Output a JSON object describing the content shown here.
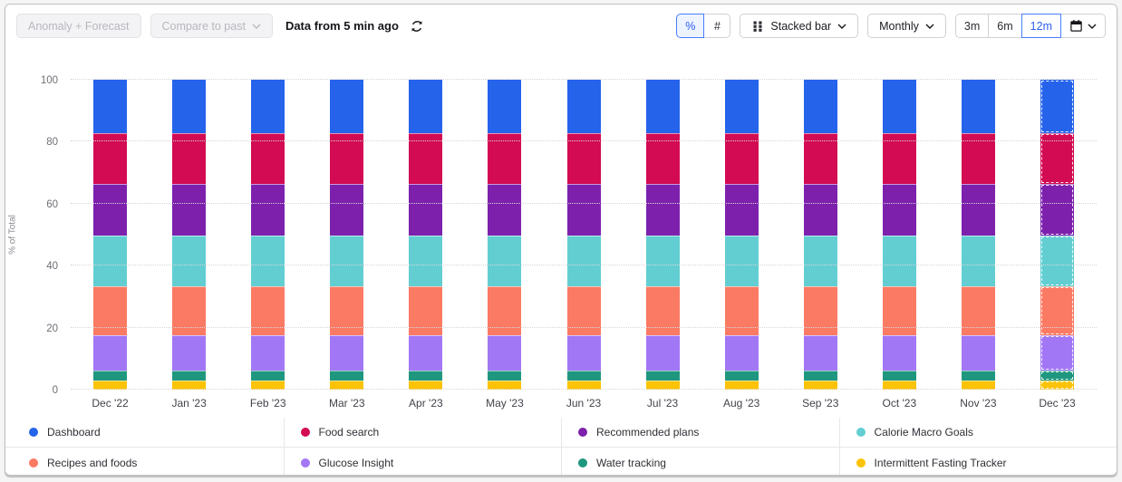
{
  "toolbar": {
    "left": {
      "anomaly_forecast_label": "Anomaly + Forecast",
      "compare_to_past_label": "Compare to past",
      "freshness_text": "Data from 5 min ago",
      "refresh_icon": "refresh-icon"
    },
    "right": {
      "unit_percent": "%",
      "unit_count": "#",
      "selected_unit": "%",
      "chart_type_label": "Stacked bar",
      "chart_type_icon": "stacked-bar-icon",
      "granularity_label": "Monthly",
      "ranges": [
        "3m",
        "6m",
        "12m"
      ],
      "selected_range": "12m",
      "date_picker_icon": "calendar-icon"
    }
  },
  "chart_data": {
    "type": "bar",
    "stacked": true,
    "title": "",
    "xlabel": "",
    "ylabel": "% of Total",
    "ylim": [
      0,
      100
    ],
    "yticks": [
      0,
      20,
      40,
      60,
      80,
      100
    ],
    "grid": "dotted-horizontal",
    "legend_position": "bottom",
    "categories": [
      "Dec '22",
      "Jan '23",
      "Feb '23",
      "Mar '23",
      "Apr '23",
      "May '23",
      "Jun '23",
      "Jul '23",
      "Aug '23",
      "Sep '23",
      "Oct '23",
      "Nov '23",
      "Dec '23"
    ],
    "incomplete_period": "Dec '23",
    "series": [
      {
        "name": "Intermittent Fasting Tracker",
        "color": "#fbc304",
        "values": [
          3.0,
          3.0,
          3.0,
          3.0,
          3.0,
          3.0,
          3.0,
          3.0,
          3.0,
          3.0,
          3.0,
          3.0,
          3.0
        ]
      },
      {
        "name": "Water tracking",
        "color": "#1f977e",
        "values": [
          3.2,
          3.2,
          3.2,
          3.2,
          3.2,
          3.2,
          3.2,
          3.2,
          3.2,
          3.2,
          3.2,
          3.2,
          3.2
        ]
      },
      {
        "name": "Glucose Insight",
        "color": "#a277f5",
        "values": [
          11.3,
          11.3,
          11.3,
          11.3,
          11.3,
          11.3,
          11.3,
          11.3,
          11.3,
          11.3,
          11.3,
          11.3,
          11.3
        ]
      },
      {
        "name": "Recipes and foods",
        "color": "#fb7a63",
        "values": [
          15.8,
          15.8,
          15.8,
          15.8,
          15.8,
          15.8,
          15.8,
          15.8,
          15.8,
          15.8,
          15.8,
          15.8,
          15.8
        ]
      },
      {
        "name": "Calorie Macro Goals",
        "color": "#62ced2",
        "values": [
          16.4,
          16.4,
          16.4,
          16.4,
          16.4,
          16.4,
          16.4,
          16.4,
          16.4,
          16.4,
          16.4,
          16.4,
          16.4
        ]
      },
      {
        "name": "Recommended plans",
        "color": "#7d21ad",
        "values": [
          16.6,
          16.6,
          16.6,
          16.6,
          16.6,
          16.6,
          16.6,
          16.6,
          16.6,
          16.6,
          16.6,
          16.6,
          16.6
        ]
      },
      {
        "name": "Food search",
        "color": "#d30b52",
        "values": [
          16.4,
          16.4,
          16.4,
          16.4,
          16.4,
          16.4,
          16.4,
          16.4,
          16.4,
          16.4,
          16.4,
          16.4,
          16.4
        ]
      },
      {
        "name": "Dashboard",
        "color": "#2563eb",
        "values": [
          17.3,
          17.3,
          17.3,
          17.3,
          17.3,
          17.3,
          17.3,
          17.3,
          17.3,
          17.3,
          17.3,
          17.3,
          17.3
        ]
      }
    ]
  },
  "legend": {
    "order": [
      "Dashboard",
      "Food search",
      "Recommended plans",
      "Calorie Macro Goals",
      "Recipes and foods",
      "Glucose Insight",
      "Water tracking",
      "Intermittent Fasting Tracker"
    ]
  },
  "colors": {
    "accent_blue": "#2c5ef0",
    "selected_bg": "#edf3ff"
  }
}
